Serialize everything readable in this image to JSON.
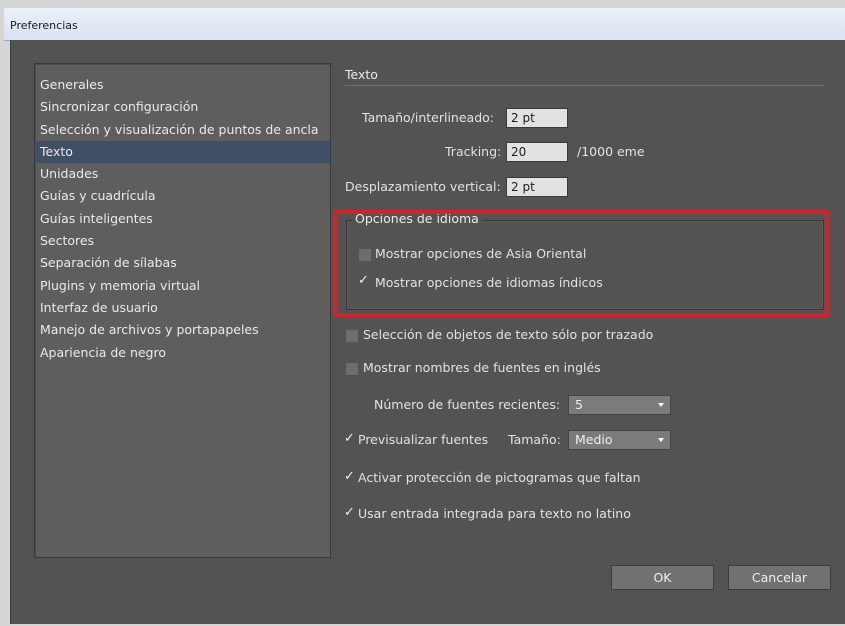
{
  "window": {
    "title": "Preferencias"
  },
  "sidebar": {
    "items": [
      {
        "label": "Generales"
      },
      {
        "label": "Sincronizar configuración"
      },
      {
        "label": "Selección y visualización de puntos de ancla"
      },
      {
        "label": "Texto"
      },
      {
        "label": "Unidades"
      },
      {
        "label": "Guías y cuadrícula"
      },
      {
        "label": "Guías inteligentes"
      },
      {
        "label": "Sectores"
      },
      {
        "label": "Separación de sílabas"
      },
      {
        "label": "Plugins y memoria virtual"
      },
      {
        "label": "Interfaz de usuario"
      },
      {
        "label": "Manejo de archivos y portapapeles"
      },
      {
        "label": "Apariencia de negro"
      }
    ],
    "selected": "Texto"
  },
  "text_panel": {
    "section_title": "Texto",
    "size_leading": {
      "label": "Tamaño/interlineado:",
      "value": "2 pt"
    },
    "tracking": {
      "label": "Tracking:",
      "value": "20",
      "unit": "/1000 eme"
    },
    "baseline_shift": {
      "label": "Desplazamiento vertical:",
      "value": "2 pt"
    },
    "language_options": {
      "legend": "Opciones de idioma",
      "east_asian": {
        "label": "Mostrar opciones de Asia Oriental",
        "checked": false
      },
      "indic": {
        "label": "Mostrar opciones de idiomas índicos",
        "checked": true
      }
    },
    "type_object_selection": {
      "label": "Selección de objetos de texto sólo por trazado",
      "checked": false
    },
    "show_font_names_english": {
      "label": "Mostrar nombres de fuentes en inglés",
      "checked": false
    },
    "recent_fonts": {
      "label": "Número de fuentes recientes:",
      "value": "5"
    },
    "font_preview": {
      "label": "Previsualizar fuentes",
      "checked": true,
      "size_label": "Tamaño:",
      "size_value": "Medio"
    },
    "missing_glyph_protection": {
      "label": "Activar protección de pictogramas que faltan",
      "checked": true
    },
    "inline_input": {
      "label": "Usar entrada integrada para texto no latino",
      "checked": true
    }
  },
  "buttons": {
    "ok": "OK",
    "cancel": "Cancelar"
  },
  "colors": {
    "dialog_bg": "#535353",
    "selection": "#404e66",
    "highlight_frame": "#d0232a"
  },
  "icons": {
    "checkmark": "check-icon",
    "dropdown": "chevron-down-icon"
  }
}
